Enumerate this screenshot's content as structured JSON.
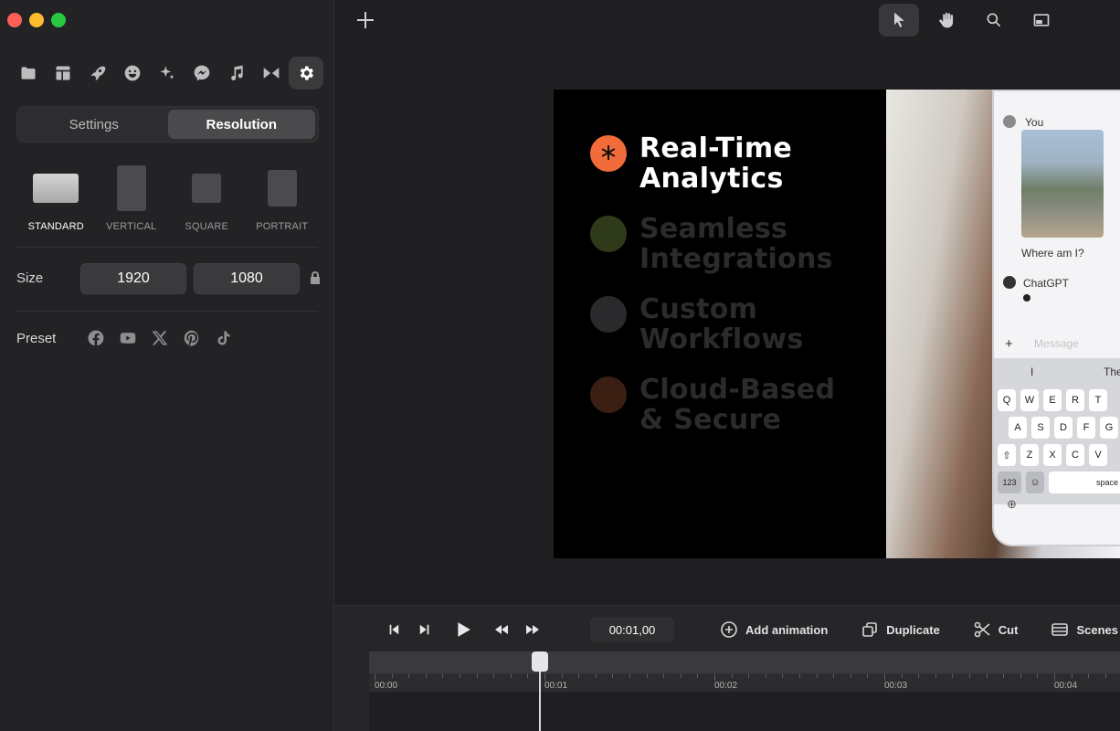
{
  "window": {
    "controls": [
      "close",
      "minimize",
      "maximize"
    ]
  },
  "sidebar": {
    "toolbar": [
      {
        "icon": "folder-icon"
      },
      {
        "icon": "layout-icon"
      },
      {
        "icon": "rocket-icon"
      },
      {
        "icon": "smiley-icon"
      },
      {
        "icon": "sparkles-icon"
      },
      {
        "icon": "messenger-icon"
      },
      {
        "icon": "music-note-icon"
      },
      {
        "icon": "transition-icon"
      },
      {
        "icon": "gear-icon",
        "active": true
      }
    ],
    "tabs": {
      "settings": "Settings",
      "resolution": "Resolution",
      "active": "Resolution"
    },
    "formats": [
      {
        "label": "STANDARD",
        "active": true
      },
      {
        "label": "VERTICAL"
      },
      {
        "label": "SQUARE"
      },
      {
        "label": "PORTRAIT"
      }
    ],
    "size": {
      "label": "Size",
      "width": "1920",
      "height": "1080"
    },
    "preset": {
      "label": "Preset",
      "icons": [
        "facebook-icon",
        "youtube-icon",
        "x-icon",
        "pinterest-icon",
        "tiktok-icon"
      ]
    }
  },
  "topbar": {
    "tools": [
      "pointer-icon",
      "hand-icon",
      "search-icon",
      "picture-in-picture-icon"
    ],
    "active": "pointer-icon"
  },
  "slide": {
    "items": [
      {
        "line1": "Real-Time",
        "line2": "Analytics",
        "color": "#ffffff",
        "bullet": "#f26b3a"
      },
      {
        "line1": "Seamless",
        "line2": "Integrations",
        "color": "#2b2b2b",
        "bullet": "#2f3a1a"
      },
      {
        "line1": "Custom",
        "line2": "Workflows",
        "color": "#2b2b2b",
        "bullet": "#2a2a2c"
      },
      {
        "line1": "Cloud-Based",
        "line2": "& Secure",
        "color": "#2b2b2b",
        "bullet": "#3b1f12"
      }
    ],
    "phone": {
      "you": "You",
      "question": "Where am I?",
      "assistant": "ChatGPT",
      "input_placeholder": "Message",
      "suggestion_1": "I",
      "suggestion_2": "The",
      "row1": [
        "Q",
        "W",
        "E",
        "R",
        "T"
      ],
      "row2": [
        "A",
        "S",
        "D",
        "F",
        "G"
      ],
      "row3": [
        "Z",
        "X",
        "C",
        "V"
      ],
      "num_key": "123",
      "space_key": "space"
    }
  },
  "timeline": {
    "timecode": "00:01,00",
    "actions": {
      "add_animation": "Add animation",
      "duplicate": "Duplicate",
      "cut": "Cut",
      "scenes": "Scenes"
    },
    "ruler_labels": [
      "00:00",
      "00:01",
      "00:02",
      "00:03",
      "00:04"
    ]
  }
}
